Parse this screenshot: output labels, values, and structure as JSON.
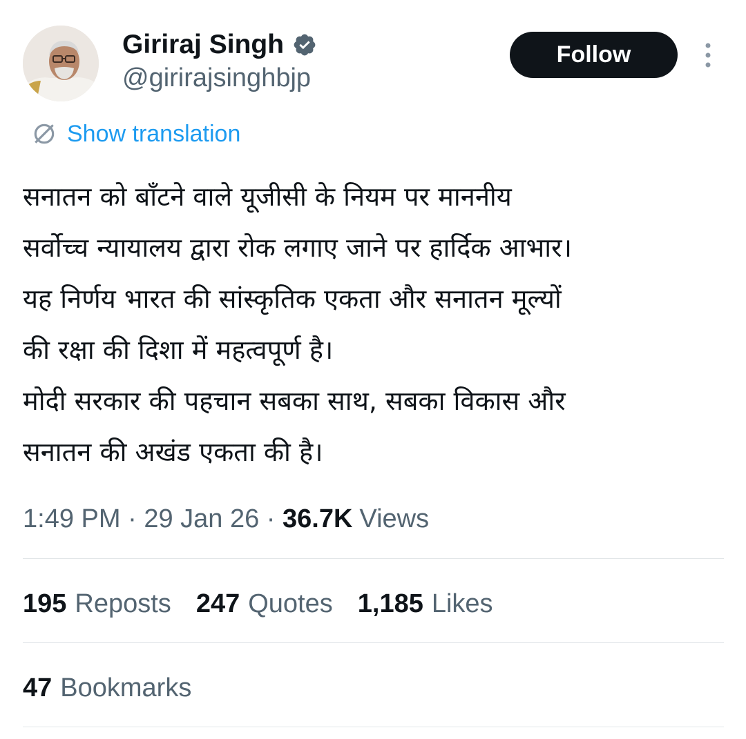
{
  "author": {
    "display_name": "Giriraj Singh",
    "handle": "@girirajsinghbjp",
    "verified_icon": "verified-badge-icon",
    "verified_color": "#536471"
  },
  "header": {
    "follow_label": "Follow",
    "more_icon": "more-vertical-icon"
  },
  "translation": {
    "label": "Show translation",
    "icon": "globe-icon",
    "color": "#1d9bf0"
  },
  "tweet": {
    "lines": [
      "सनातन को बाँटने वाले यूजीसी के नियम पर माननीय",
      "सर्वोच्च न्यायालय द्वारा रोक लगाए जाने पर हार्दिक आभार।",
      "यह निर्णय भारत की सांस्कृतिक एकता और सनातन मूल्यों",
      "की रक्षा की दिशा में महत्वपूर्ण है।",
      "मोदी सरकार की पहचान सबका साथ, सबका विकास और",
      "सनातन की अखंड एकता की है।"
    ]
  },
  "meta": {
    "time": "1:49 PM",
    "separator": " · ",
    "date": "29 Jan 26",
    "views_count": "36.7K",
    "views_label": "Views"
  },
  "stats": {
    "reposts_count": "195",
    "reposts_label": "Reposts",
    "quotes_count": "247",
    "quotes_label": "Quotes",
    "likes_count": "1,185",
    "likes_label": "Likes",
    "bookmarks_count": "47",
    "bookmarks_label": "Bookmarks"
  },
  "colors": {
    "text_primary": "#0f1419",
    "text_secondary": "#536471",
    "link": "#1d9bf0",
    "button_bg": "#0f1419",
    "divider": "#e1e5e8"
  }
}
